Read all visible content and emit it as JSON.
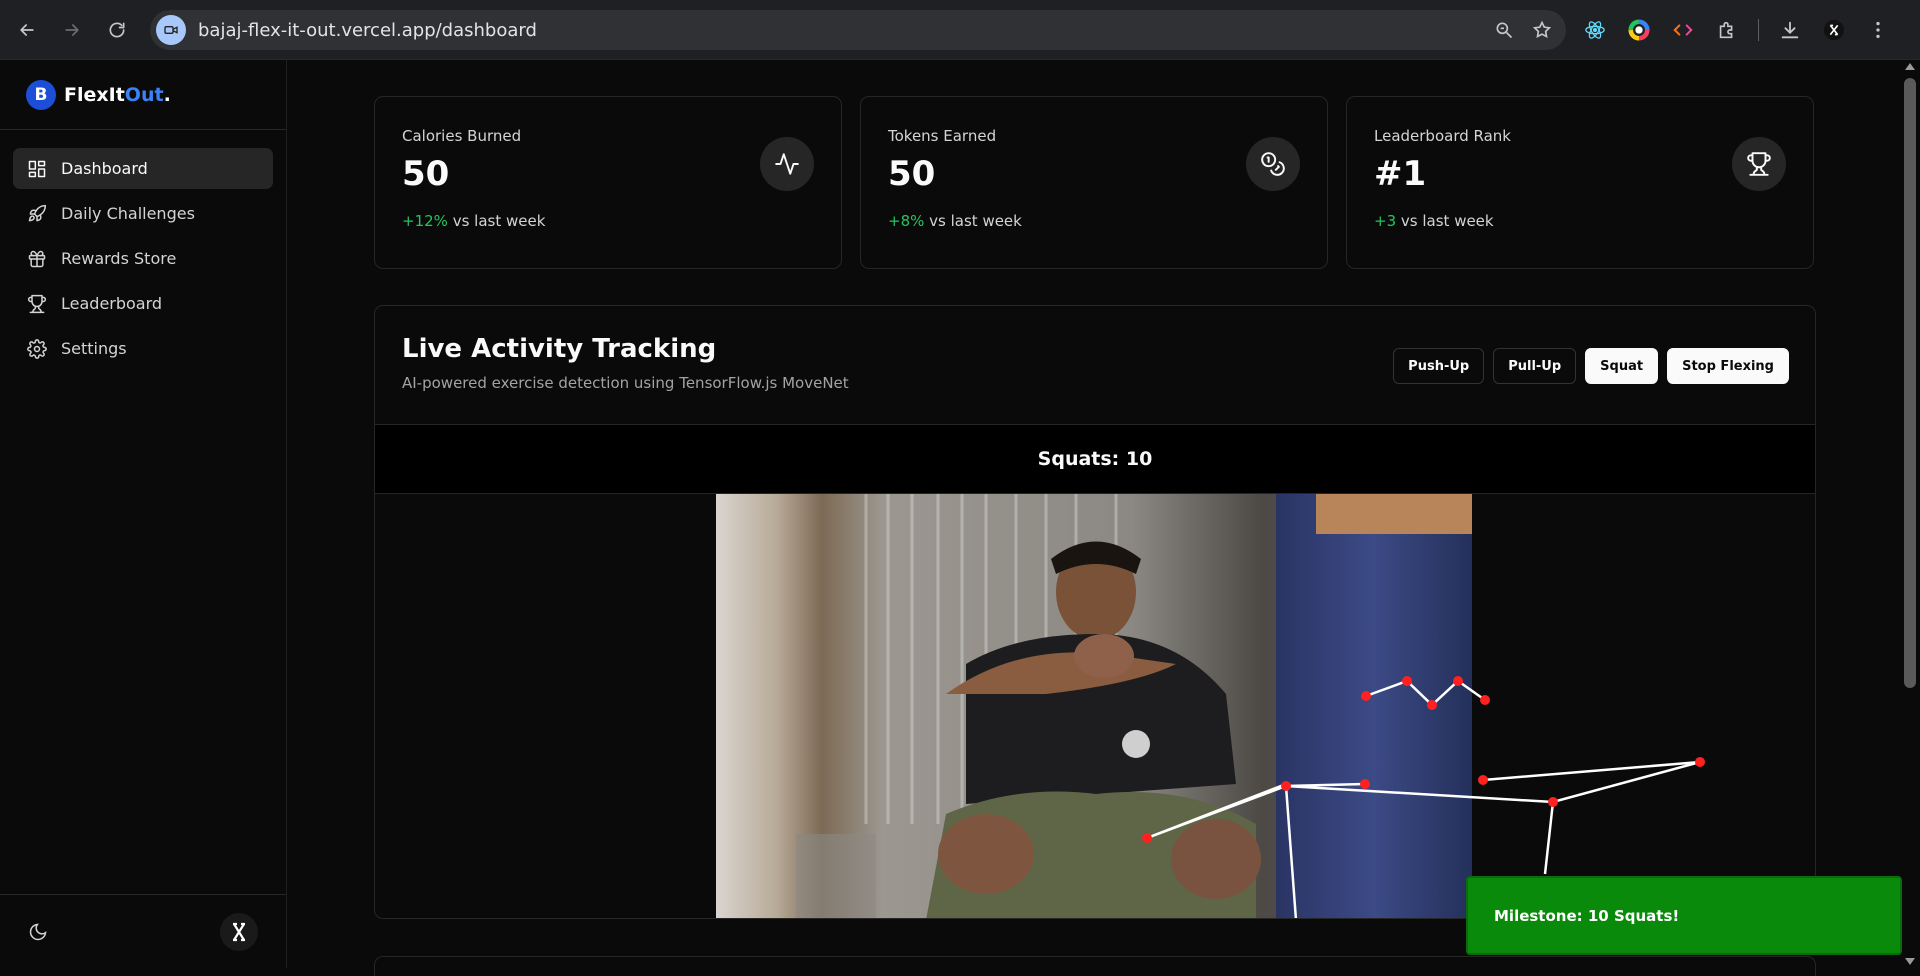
{
  "browser": {
    "url": "bajaj-flex-it-out.vercel.app/dashboard"
  },
  "sidebar": {
    "brand_first": "FlexIt",
    "brand_accent": "Out",
    "brand_dot": ".",
    "brand_logo_letter": "B",
    "items": [
      {
        "label": "Dashboard",
        "icon": "dashboard-icon",
        "active": true
      },
      {
        "label": "Daily Challenges",
        "icon": "rocket-icon",
        "active": false
      },
      {
        "label": "Rewards Store",
        "icon": "gift-icon",
        "active": false
      },
      {
        "label": "Leaderboard",
        "icon": "trophy-icon",
        "active": false
      },
      {
        "label": "Settings",
        "icon": "gear-icon",
        "active": false
      }
    ]
  },
  "stats": [
    {
      "label": "Calories Burned",
      "value": "50",
      "delta": "+12%",
      "delta_suffix": "vs last week",
      "icon": "activity-icon"
    },
    {
      "label": "Tokens Earned",
      "value": "50",
      "delta": "+8%",
      "delta_suffix": "vs last week",
      "icon": "coins-icon"
    },
    {
      "label": "Leaderboard Rank",
      "value": "#1",
      "delta": "+3",
      "delta_suffix": "vs last week",
      "icon": "trophy-icon"
    }
  ],
  "tracking": {
    "title": "Live Activity Tracking",
    "subtitle": "AI-powered exercise detection using TensorFlow.js MoveNet",
    "buttons": {
      "pushup": "Push-Up",
      "pullup": "Pull-Up",
      "squat": "Squat",
      "stop": "Stop Flexing"
    },
    "counter": "Squats: 10"
  },
  "toast": {
    "message": "Milestone: 10 Squats!"
  },
  "colors": {
    "accent": "#3b82f6",
    "positive": "#22c55e",
    "toast_bg": "#0a8a0a",
    "keypoint": "#ff2020"
  }
}
